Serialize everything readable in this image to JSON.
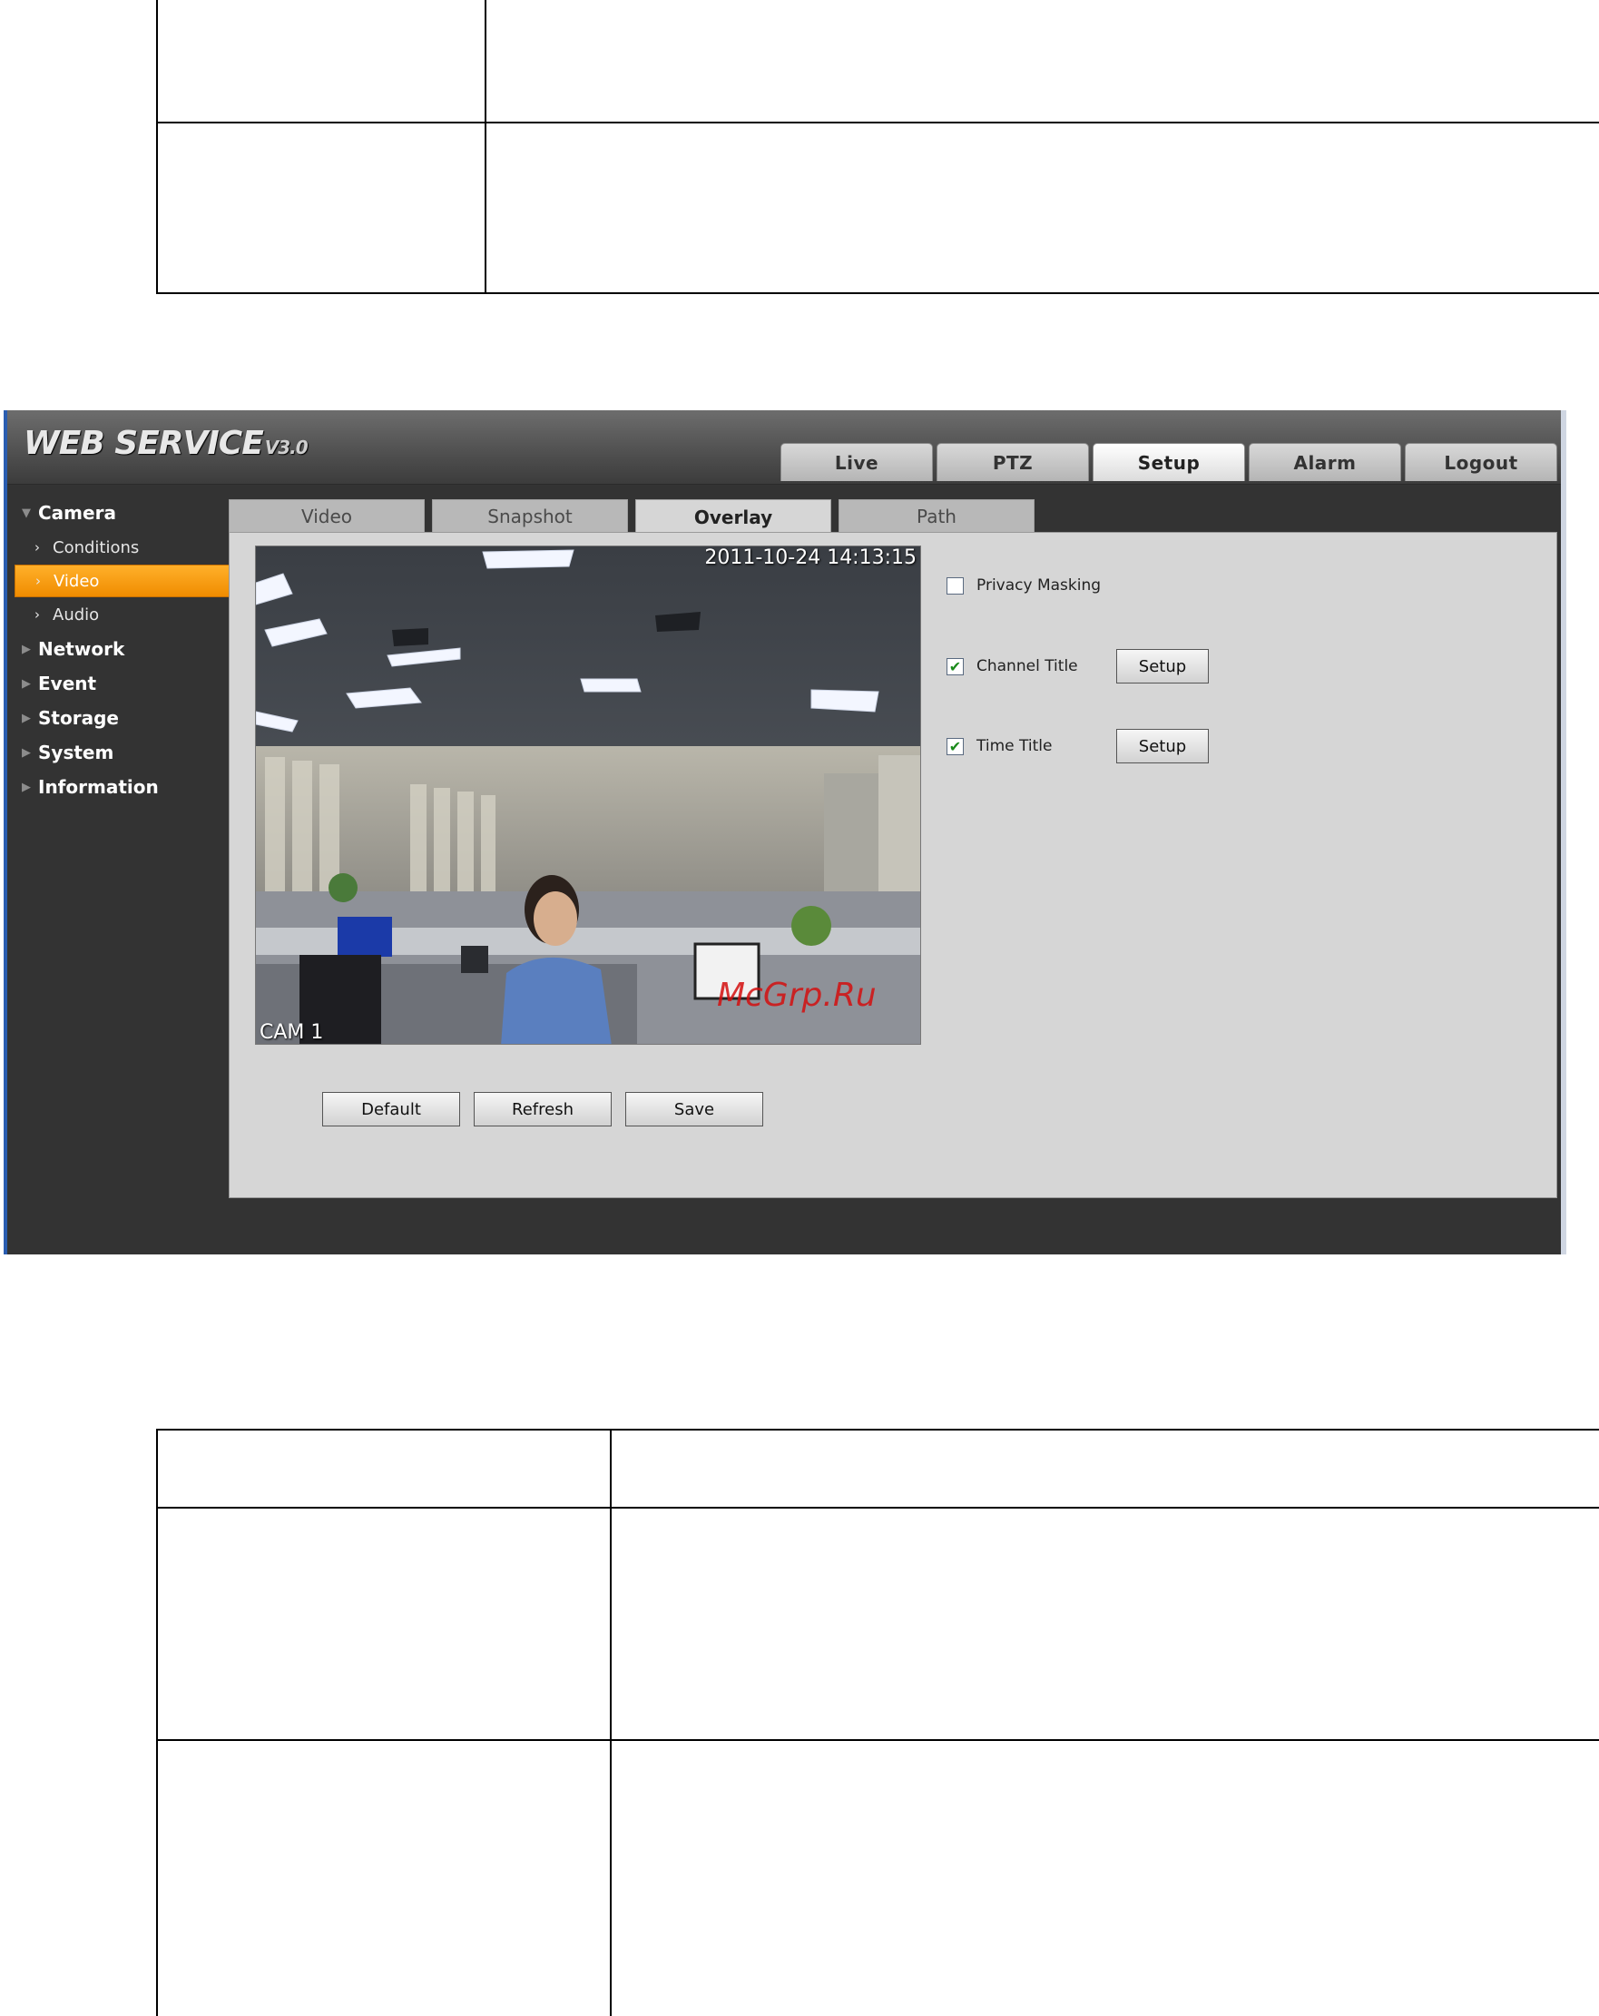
{
  "app": {
    "brand": "WEB SERVICE",
    "version": "V3.0",
    "nav": [
      "Live",
      "PTZ",
      "Setup",
      "Alarm",
      "Logout"
    ],
    "active_nav": "Setup"
  },
  "sidebar": {
    "camera": "Camera",
    "camera_items": [
      "Conditions",
      "Video",
      "Audio"
    ],
    "active_item": "Video",
    "groups": [
      "Network",
      "Event",
      "Storage",
      "System",
      "Information"
    ]
  },
  "sub_tabs": [
    "Video",
    "Snapshot",
    "Overlay",
    "Path"
  ],
  "active_sub_tab": "Overlay",
  "preview": {
    "time_osd": "2011-10-24 14:13:15",
    "channel_osd": "CAM 1",
    "watermark": "McGrp.Ru"
  },
  "options": {
    "privacy_masking": {
      "label": "Privacy Masking",
      "checked": false
    },
    "channel_title": {
      "label": "Channel Title",
      "checked": true,
      "button": "Setup"
    },
    "time_title": {
      "label": "Time Title",
      "checked": true,
      "button": "Setup"
    }
  },
  "actions": {
    "default": "Default",
    "refresh": "Refresh",
    "save": "Save"
  },
  "colors": {
    "accent": "#f39a00",
    "frame_border": "#2a5db0"
  }
}
